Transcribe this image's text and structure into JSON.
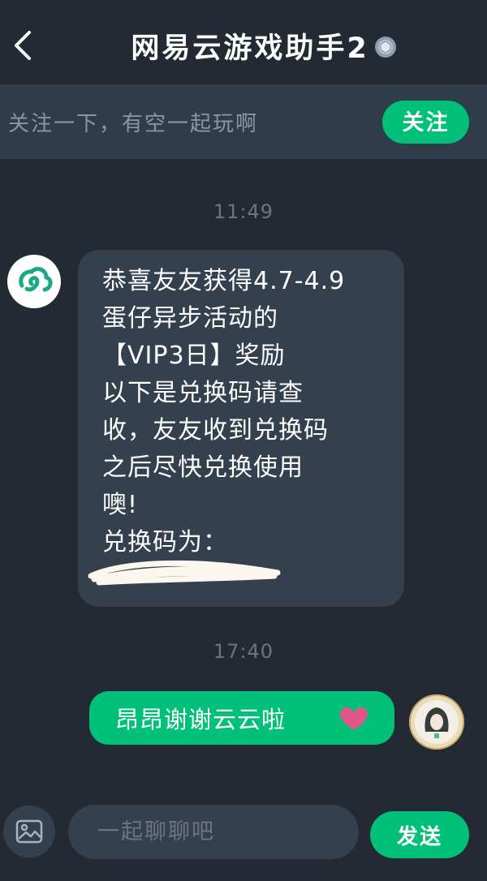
{
  "header": {
    "title": "网易云游戏助手2",
    "back_icon": "chevron-left-icon",
    "badge_icon": "verified-badge-icon"
  },
  "follow_bar": {
    "text": "关注一下，有空一起玩啊",
    "button_label": "关注"
  },
  "messages": [
    {
      "timestamp": "11:49",
      "sender": "assistant",
      "avatar_icon": "netease-cloud-game-logo-icon",
      "lines": [
        "恭喜友友获得4.7-4.9",
        "蛋仔异步活动的",
        "【VIP3日】奖励",
        "以下是兑换码请查",
        "收，友友收到兑换码",
        "之后尽快兑换使用",
        "噢!",
        "兑换码为："
      ]
    },
    {
      "timestamp": "17:40",
      "sender": "me",
      "text": "昂昂谢谢云云啦",
      "emoji_icon": "heart-icon"
    }
  ],
  "input": {
    "placeholder": "一起聊聊吧",
    "value": "",
    "send_label": "发送",
    "image_icon": "image-icon"
  },
  "colors": {
    "background": "#242a33",
    "banner": "#2f3d4b",
    "bubble_in": "#34404e",
    "accent": "#00c07a",
    "heart": "#e0558a"
  }
}
